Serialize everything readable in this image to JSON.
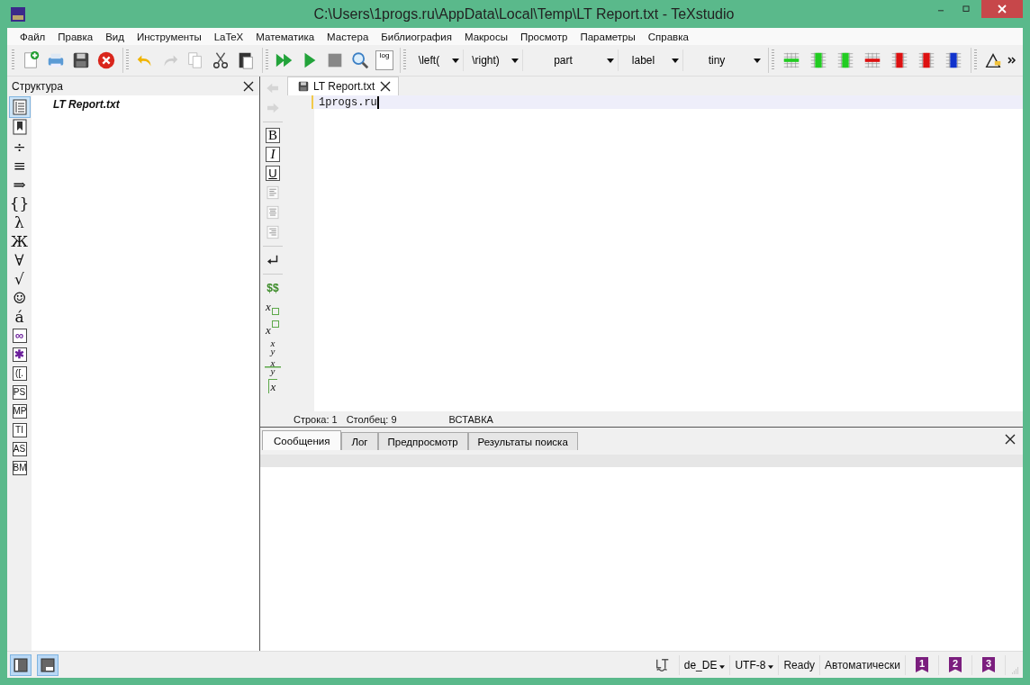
{
  "window": {
    "title": "C:\\Users\\1progs.ru\\AppData\\Local\\Temp\\LT Report.txt - TeXstudio"
  },
  "menu": [
    "Файл",
    "Правка",
    "Вид",
    "Инструменты",
    "LaTeX",
    "Математика",
    "Мастера",
    "Библиография",
    "Макросы",
    "Просмотр",
    "Параметры",
    "Справка"
  ],
  "toolbar": {
    "log_label": "log",
    "combos": [
      "\\left(",
      "\\right)",
      "part",
      "label",
      "tiny"
    ]
  },
  "structure": {
    "title": "Структура",
    "tools": [
      {
        "kind": "structure",
        "selected": true
      },
      {
        "kind": "bookmarks",
        "selected": false
      },
      {
        "kind": "glyph",
        "label": "÷",
        "selected": false
      },
      {
        "kind": "glyph",
        "label": "≡",
        "selected": false
      },
      {
        "kind": "glyph",
        "label": "⇒",
        "selected": false
      },
      {
        "kind": "glyph",
        "label": "{}",
        "selected": false
      },
      {
        "kind": "glyph",
        "label": "λ",
        "selected": false
      },
      {
        "kind": "glyph",
        "label": "Ж",
        "selected": false
      },
      {
        "kind": "glyph",
        "label": "∀",
        "selected": false
      },
      {
        "kind": "glyph",
        "label": "√",
        "selected": false
      },
      {
        "kind": "glyph",
        "label": "☺",
        "selected": false
      },
      {
        "kind": "glyph",
        "label": "á",
        "selected": false
      },
      {
        "kind": "accent",
        "label": "∞",
        "selected": false
      },
      {
        "kind": "accent",
        "label": "✱",
        "selected": false
      },
      {
        "kind": "boxed",
        "label": "([.",
        "selected": false
      },
      {
        "kind": "boxed",
        "label": "PS",
        "selected": false
      },
      {
        "kind": "boxed",
        "label": "MP",
        "selected": false
      },
      {
        "kind": "boxed",
        "label": "TI",
        "selected": false
      },
      {
        "kind": "boxed",
        "label": "AS",
        "selected": false
      },
      {
        "kind": "boxed",
        "label": "BM",
        "selected": false
      }
    ],
    "tree": [
      {
        "label": "LT Report.txt"
      }
    ]
  },
  "editor": {
    "tabs": [
      {
        "label": "LT Report.txt",
        "selected": true
      }
    ],
    "tools": [
      {
        "kind": "back",
        "disabled": true
      },
      {
        "kind": "forward",
        "disabled": true
      },
      {
        "kind": "separator"
      },
      {
        "kind": "bold",
        "label": "B"
      },
      {
        "kind": "italic",
        "label": "I"
      },
      {
        "kind": "underline",
        "label": "U"
      },
      {
        "kind": "align-left"
      },
      {
        "kind": "align-center"
      },
      {
        "kind": "align-right"
      },
      {
        "kind": "separator"
      },
      {
        "kind": "newline"
      },
      {
        "kind": "separator"
      },
      {
        "kind": "math",
        "label": "$$"
      },
      {
        "kind": "subscript",
        "label": "x"
      },
      {
        "kind": "superscript",
        "label": "x"
      },
      {
        "kind": "frac",
        "num": "x",
        "den": "y"
      },
      {
        "kind": "dfrac",
        "num": "x",
        "den": "y"
      },
      {
        "kind": "sqrt",
        "label": "x"
      }
    ],
    "lines": [
      {
        "text": "1progs.ru",
        "current": true
      }
    ],
    "status": [
      "Строка: 1",
      "Столбец: 9",
      "ВСТАВКА"
    ]
  },
  "bottom_panel": {
    "tabs": [
      {
        "label": "Сообщения",
        "selected": true
      },
      {
        "label": "Лог",
        "selected": false
      },
      {
        "label": "Предпросмотр",
        "selected": false
      },
      {
        "label": "Результаты поиска",
        "selected": false
      }
    ]
  },
  "status_bar": {
    "panel_toggles": [
      {
        "on": true
      },
      {
        "on": true
      }
    ],
    "language": "de_DE",
    "encoding": "UTF-8",
    "state": "Ready",
    "mode": "Автоматически",
    "bookmarks": [
      "1",
      "2",
      "3"
    ]
  }
}
